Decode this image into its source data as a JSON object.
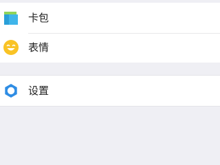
{
  "menu": {
    "items": [
      {
        "label": "卡包",
        "icon": "card-wallet-icon",
        "icon_color": "#3fb5ea"
      },
      {
        "label": "表情",
        "icon": "smiley-icon",
        "icon_color": "#f9c325"
      },
      {
        "label": "设置",
        "icon": "gear-icon",
        "icon_color": "#2f8de4"
      }
    ]
  },
  "colors": {
    "background": "#efeff4",
    "surface": "#ffffff",
    "text": "#222222"
  }
}
